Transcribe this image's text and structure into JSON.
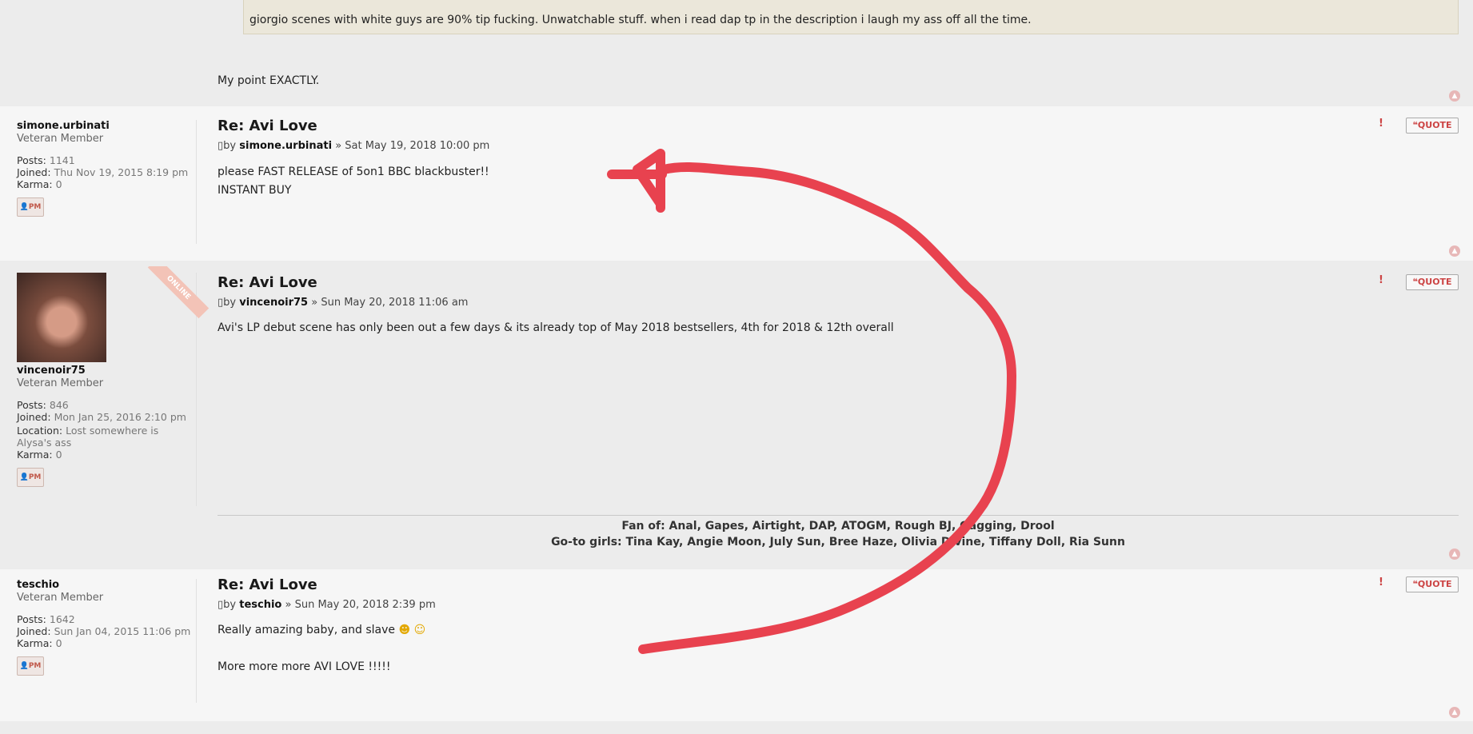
{
  "prev_post": {
    "quoted_text": "giorgio scenes with white guys are 90% tip fucking. Unwatchable stuff. when i read dap tp in the description i laugh my ass off all the time.",
    "reply_text": "My point EXACTLY."
  },
  "posts": [
    {
      "username": "simone.urbinati",
      "rank": "Veteran Member",
      "posts_label": "Posts:",
      "posts": "1141",
      "joined_label": "Joined:",
      "joined": "Thu Nov 19, 2015 8:19 pm",
      "karma_label": "Karma:",
      "karma": "0",
      "pm": "PM",
      "title": "Re: Avi Love",
      "meta_by": "by",
      "meta_author": "simone.urbinati",
      "meta_date": "» Sat May 19, 2018 10:00 pm",
      "body": [
        "please FAST RELEASE of 5on1 BBC blackbuster!!",
        "INSTANT BUY"
      ],
      "quote": "QUOTE"
    },
    {
      "username": "vincenoir75",
      "rank": "Veteran Member",
      "online": "ONLINE",
      "posts_label": "Posts:",
      "posts": "846",
      "joined_label": "Joined:",
      "joined": "Mon Jan 25, 2016 2:10 pm",
      "location_label": "Location:",
      "location": "Lost somewhere is Alysa's ass",
      "karma_label": "Karma:",
      "karma": "0",
      "pm": "PM",
      "title": "Re: Avi Love",
      "meta_by": "by",
      "meta_author": "vincenoir75",
      "meta_date": "» Sun May 20, 2018 11:06 am",
      "body": [
        "Avi's LP debut scene has only been out a few days & its already top of May 2018 bestsellers, 4th for 2018 & 12th overall"
      ],
      "sig_line1": "Fan of: Anal, Gapes, Airtight, DAP, ATOGM, Rough BJ, Gagging, Drool",
      "sig_line2": "Go-to girls: Tina Kay, Angie Moon, July Sun, Bree Haze, Olivia Divine, Tiffany Doll, Ria Sunn",
      "quote": "QUOTE"
    },
    {
      "username": "teschio",
      "rank": "Veteran Member",
      "posts_label": "Posts:",
      "posts": "1642",
      "joined_label": "Joined:",
      "joined": "Sun Jan 04, 2015 11:06 pm",
      "karma_label": "Karma:",
      "karma": "0",
      "pm": "PM",
      "title": "Re: Avi Love",
      "meta_by": "by",
      "meta_author": "teschio",
      "meta_date": "» Sun May 20, 2018 2:39 pm",
      "body": [
        "Really amazing baby, and slave",
        "More more more AVI LOVE !!!!!"
      ],
      "quote": "QUOTE"
    }
  ],
  "colors": {
    "annotation": "#e8424f",
    "quote_btn_text": "#cc4444"
  }
}
